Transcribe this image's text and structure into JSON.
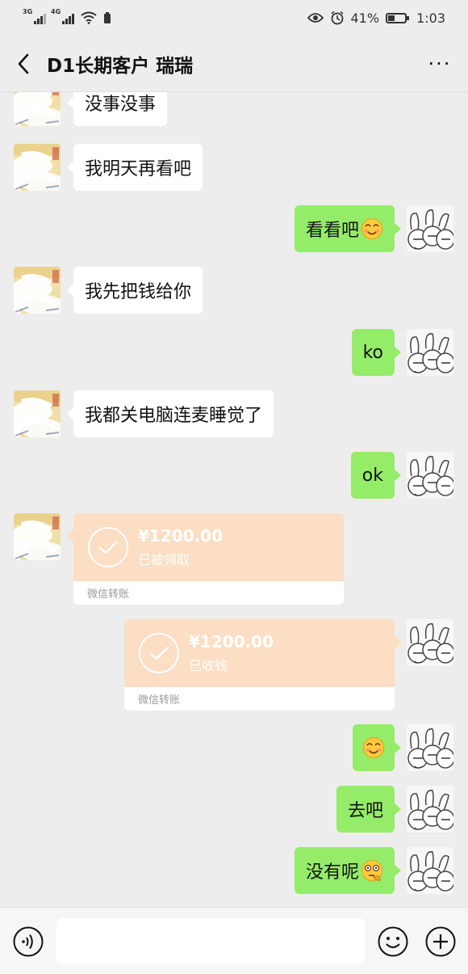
{
  "status_bar": {
    "net1": "3G",
    "net2": "4G",
    "battery": "41%",
    "battery_level": 0.41,
    "time": "1:03"
  },
  "header": {
    "title": "D1长期客户 瑞瑞",
    "more": "···"
  },
  "messages": [
    {
      "side": "left",
      "text": "没事没事"
    },
    {
      "side": "left",
      "text": "我明天再看吧"
    },
    {
      "side": "right",
      "text": "看看吧",
      "emoji": "smile-emoji"
    },
    {
      "side": "left",
      "text": "我先把钱给你"
    },
    {
      "side": "right",
      "text": "ko"
    },
    {
      "side": "left",
      "text": "我都关电脑连麦睡觉了"
    },
    {
      "side": "right",
      "text": "ok"
    },
    {
      "side": "left",
      "type": "transfer",
      "amount": "¥1200.00",
      "status": "已被领取",
      "footer": "微信转账"
    },
    {
      "side": "right",
      "type": "transfer",
      "amount": "¥1200.00",
      "status": "已收钱",
      "footer": "微信转账"
    },
    {
      "side": "right",
      "text": "",
      "emoji": "smile-emoji"
    },
    {
      "side": "right",
      "text": "去吧"
    },
    {
      "side": "right",
      "text": "没有呢",
      "emoji": "thinking-emoji"
    }
  ],
  "colors": {
    "background": "#ededed",
    "bubble_self": "#95ec69",
    "bubble_other": "#ffffff",
    "transfer": "#fbdec3"
  },
  "input_bar": {
    "placeholder": ""
  }
}
